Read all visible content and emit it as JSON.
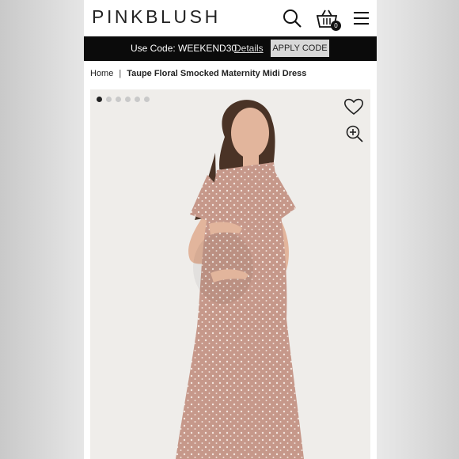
{
  "header": {
    "logo": "PINKBLUSH",
    "cart_count": "0",
    "icons": [
      "search-icon",
      "shopping-basket-icon",
      "hamburger-menu-icon"
    ]
  },
  "promo": {
    "text": "Use Code: WEEKEND30",
    "details_link": "Details",
    "apply_button": "APPLY CODE"
  },
  "breadcrumb": {
    "home": "Home",
    "separator": "|",
    "current": "Taupe Floral Smocked Maternity Midi Dress"
  },
  "gallery": {
    "slide_count": 6,
    "active_slide": 1,
    "icons": [
      "heart-icon",
      "zoom-in-icon"
    ]
  },
  "colors": {
    "promo_bg": "#0b0b0b",
    "dress": "#c89a8c",
    "background": "#efedea"
  }
}
